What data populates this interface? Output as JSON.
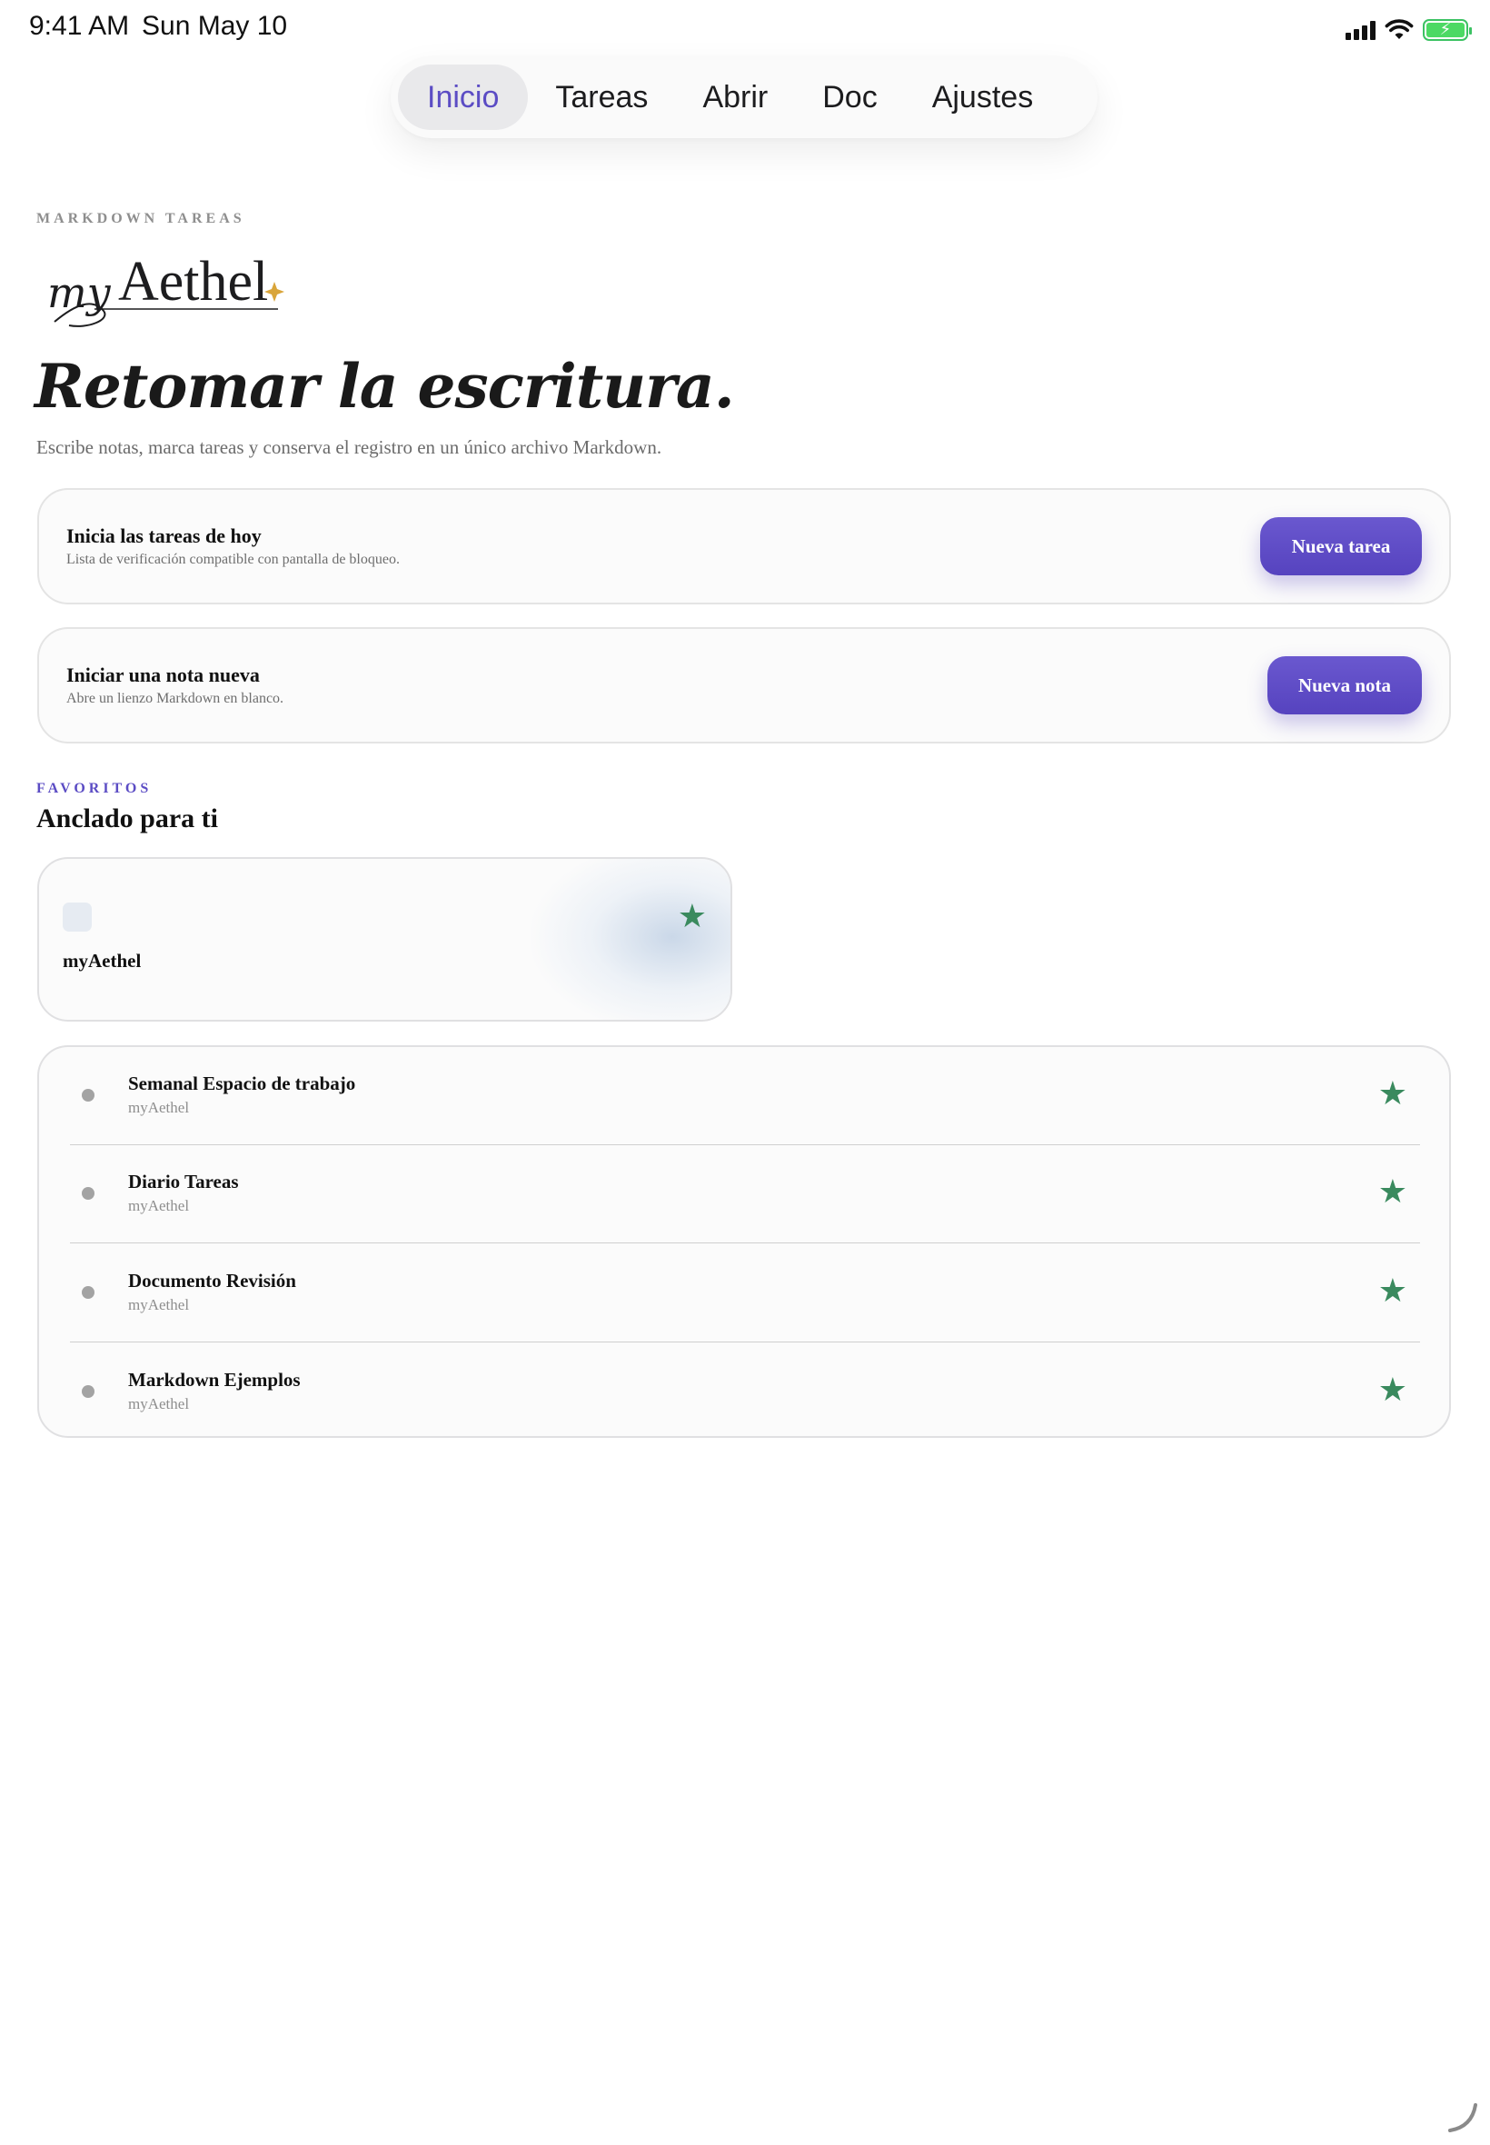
{
  "status": {
    "time": "9:41 AM",
    "date": "Sun May 10"
  },
  "tabs": [
    {
      "label": "Inicio",
      "active": true
    },
    {
      "label": "Tareas",
      "active": false
    },
    {
      "label": "Abrir",
      "active": false
    },
    {
      "label": "Doc",
      "active": false
    },
    {
      "label": "Ajustes",
      "active": false
    }
  ],
  "header": {
    "eyebrow": "MARKDOWN TAREAS",
    "logo_text": "myAethel",
    "title": "Retomar la escritura.",
    "subtitle": "Escribe notas, marca tareas y conserva el registro en un único archivo Markdown."
  },
  "actions": [
    {
      "title": "Inicia las tareas de hoy",
      "description": "Lista de verificación compatible con pantalla de bloqueo.",
      "button": "Nueva tarea"
    },
    {
      "title": "Iniciar una nota nueva",
      "description": "Abre un lienzo Markdown en blanco.",
      "button": "Nueva nota"
    }
  ],
  "favorites": {
    "eyebrow": "FAVORITOS",
    "title": "Anclado para ti",
    "pinned": {
      "name": "myAethel",
      "icon": "star-icon"
    },
    "items": [
      {
        "title": "Semanal Espacio de trabajo",
        "subtitle": "myAethel"
      },
      {
        "title": "Diario Tareas",
        "subtitle": "myAethel"
      },
      {
        "title": "Documento Revisión",
        "subtitle": "myAethel"
      },
      {
        "title": "Markdown Ejemplos",
        "subtitle": "myAethel"
      }
    ]
  },
  "colors": {
    "accent": "#5b4cc4",
    "star": "#3a8a5e",
    "battery": "#4cd964",
    "logo_sparkle": "#d9a53a"
  }
}
